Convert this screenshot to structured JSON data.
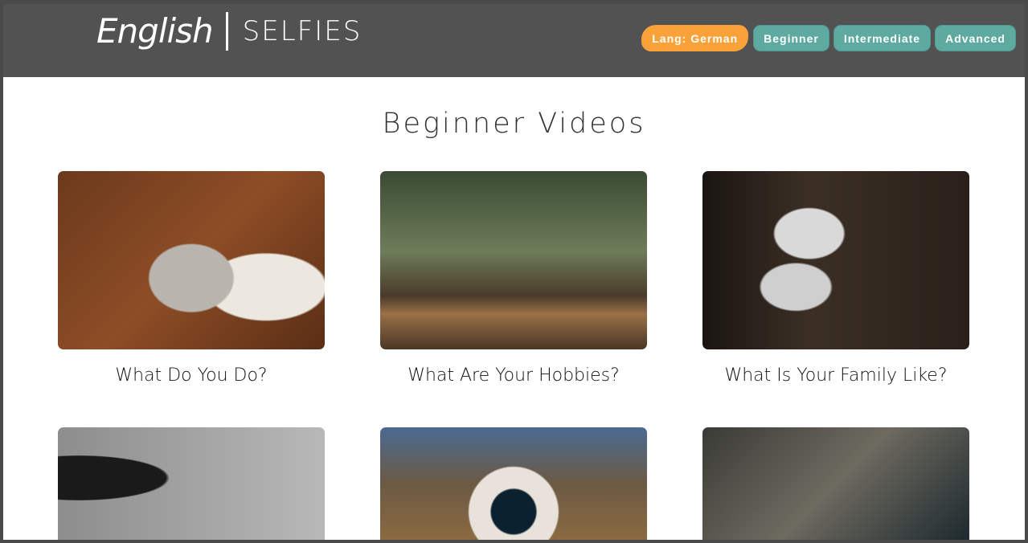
{
  "header": {
    "logo_script": "English",
    "logo_text": "SELFIES",
    "nav": [
      {
        "label": "Lang: German",
        "color": "#f9a23a"
      },
      {
        "label": "Beginner",
        "color": "#5ea9a0"
      },
      {
        "label": "Intermediate",
        "color": "#5ea9a0"
      },
      {
        "label": "Advanced",
        "color": "#5ea9a0"
      }
    ]
  },
  "main": {
    "title": "Beginner Videos",
    "videos": [
      {
        "title": "What Do You Do?"
      },
      {
        "title": "What Are Your Hobbies?"
      },
      {
        "title": "What Is Your Family Like?"
      },
      {
        "title": ""
      },
      {
        "title": ""
      },
      {
        "title": ""
      }
    ]
  }
}
